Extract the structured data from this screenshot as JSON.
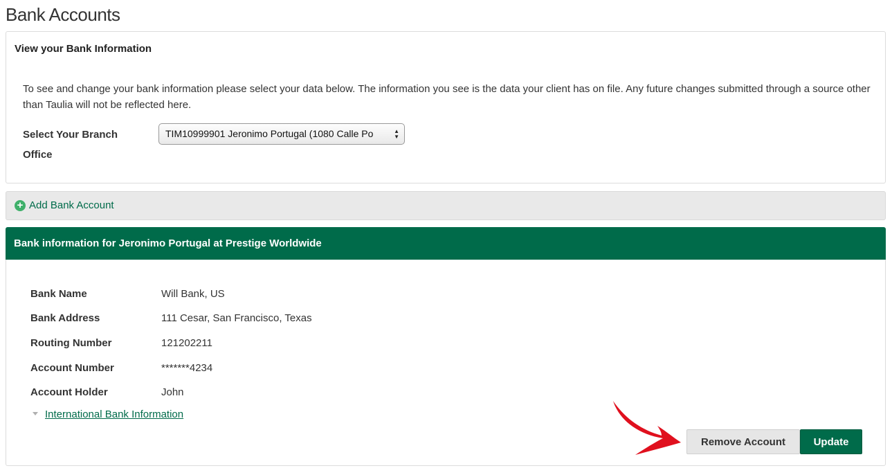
{
  "page": {
    "title": "Bank Accounts"
  },
  "view_panel": {
    "title": "View your Bank Information",
    "intro": "To see and change your bank information please select your data below. The information you see is the data your client has on file. Any future changes submitted through a source other than Taulia will not be reflected here.",
    "branch_label": "Select Your Branch Office",
    "branch_selected": "TIM10999901 Jeronimo Portugal (1080 Calle Po"
  },
  "add_bar": {
    "label": "Add Bank Account",
    "icon": "plus-circle-icon"
  },
  "bank_panel": {
    "header": "Bank information for Jeronimo Portugal at Prestige Worldwide",
    "fields": [
      {
        "label": "Bank Name",
        "value": "Will Bank, US"
      },
      {
        "label": "Bank Address",
        "value": "111 Cesar, San Francisco, Texas"
      },
      {
        "label": "Routing Number",
        "value": "121202211"
      },
      {
        "label": "Account Number",
        "value": "*******4234"
      },
      {
        "label": "Account Holder",
        "value": "John"
      }
    ],
    "international_link": "International Bank Information",
    "remove_button": "Remove Account",
    "update_button": "Update"
  },
  "colors": {
    "brand_green": "#006b4a",
    "annotation_red": "#e0101e"
  }
}
